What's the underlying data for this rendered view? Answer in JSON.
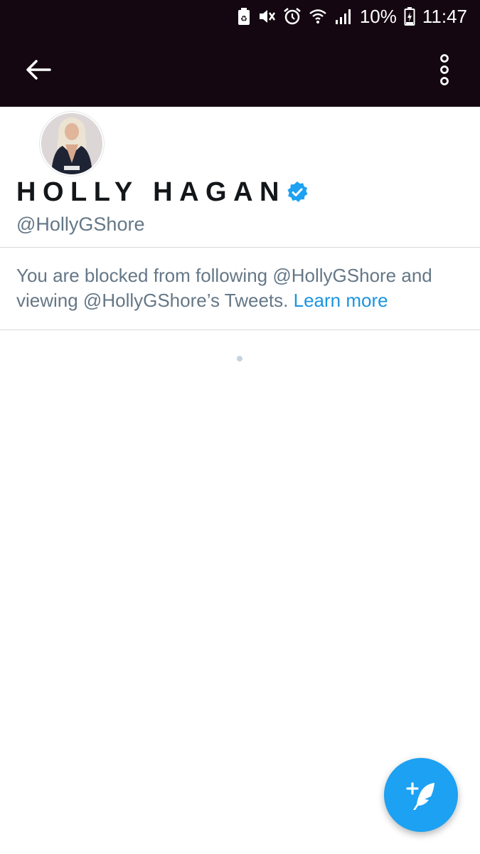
{
  "status_bar": {
    "battery_percent": "10%",
    "time": "11:47",
    "icons": [
      "battery-saver-icon",
      "vibrate-mute-icon",
      "alarm-icon",
      "wifi-icon",
      "signal-icon",
      "battery-charging-icon"
    ]
  },
  "app_bar": {
    "back_icon": "arrow-left-icon",
    "overflow_icon": "more-vert-icon"
  },
  "profile": {
    "display_name": "HOLLY HAGAN",
    "handle": "@HollyGShore",
    "verified": true
  },
  "blocked_notice": {
    "message": "You are blocked from following @HollyGShore and viewing @HollyGShore’s Tweets.",
    "link_label": "Learn more"
  },
  "fab": {
    "icon": "compose-tweet-icon"
  },
  "colors": {
    "app_bar": "#140711",
    "accent": "#1da1f2",
    "link": "#1b95e0",
    "secondary_text": "#657786",
    "verified_badge": "#1da1f2"
  }
}
